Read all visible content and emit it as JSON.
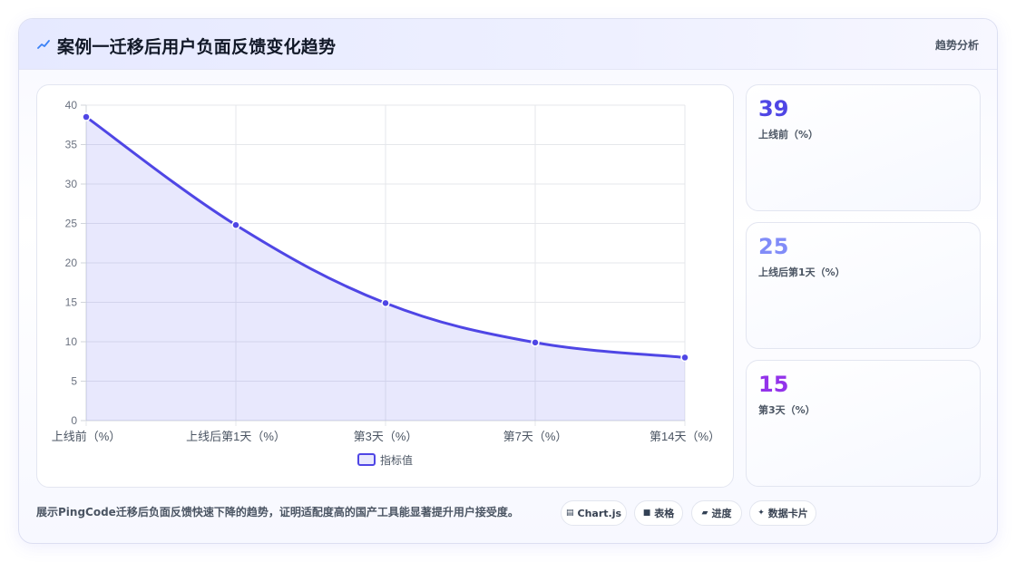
{
  "header": {
    "title": "案例一迁移后用户负面反馈变化趋势",
    "tag": "趋势分析"
  },
  "chart_data": {
    "type": "area",
    "categories": [
      "上线前（%）",
      "上线后第1天（%）",
      "第3天（%）",
      "第7天（%）",
      "第14天（%）"
    ],
    "series": [
      {
        "name": "指标值",
        "values": [
          38.5,
          24.8,
          14.9,
          9.9,
          8.0
        ]
      }
    ],
    "ylim": [
      0,
      40
    ],
    "yticks": [
      0,
      5,
      10,
      15,
      20,
      25,
      30,
      35,
      40
    ],
    "grid": true,
    "legend": "bottom",
    "colors": {
      "line": "#4f46e5",
      "fill": "rgba(99,102,241,0.15)"
    }
  },
  "stats": [
    {
      "value": "39",
      "label": "上线前（%）",
      "color": "#4f46e5"
    },
    {
      "value": "25",
      "label": "上线后第1天（%）",
      "color": "#818cf8"
    },
    {
      "value": "15",
      "label": "第3天（%）",
      "color": "#9333ea"
    }
  ],
  "footer": {
    "description": "展示PingCode迁移后负面反馈快速下降的趋势，证明适配度高的国产工具能显著提升用户接受度。",
    "chips": [
      {
        "icon": "chart-icon",
        "label": "Chart.js"
      },
      {
        "icon": "table-icon",
        "label": "表格"
      },
      {
        "icon": "progress-icon",
        "label": "进度"
      },
      {
        "icon": "sparkle-icon",
        "label": "数据卡片"
      }
    ]
  }
}
